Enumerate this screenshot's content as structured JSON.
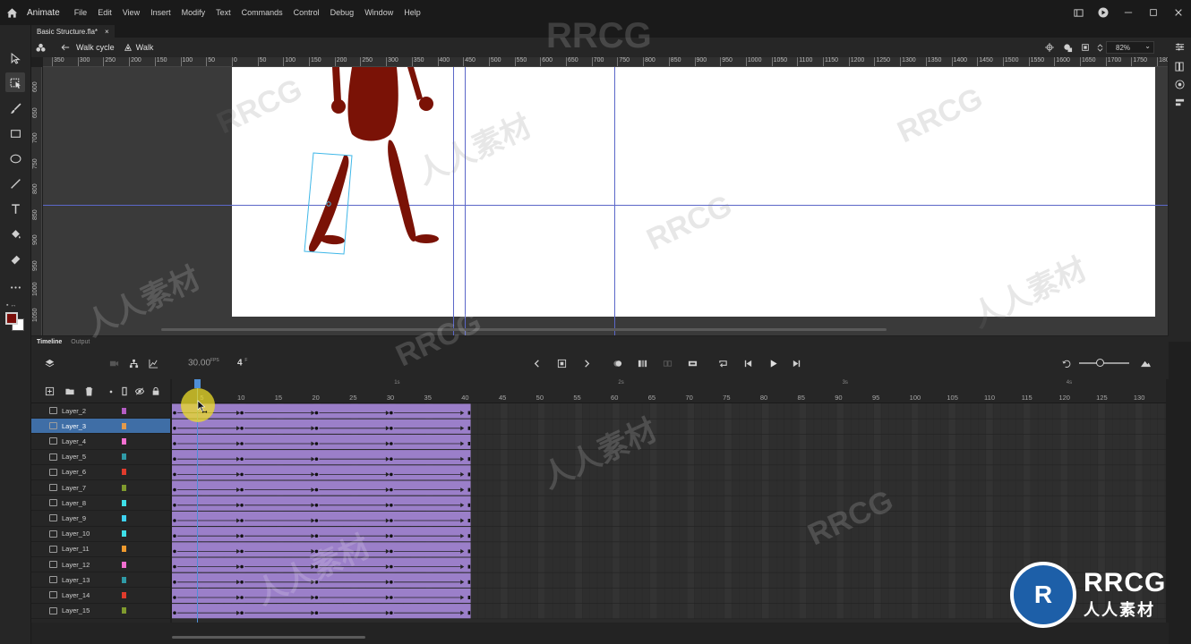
{
  "app": {
    "name": "Animate",
    "menu": [
      "File",
      "Edit",
      "View",
      "Insert",
      "Modify",
      "Text",
      "Commands",
      "Control",
      "Debug",
      "Window",
      "Help"
    ]
  },
  "document_tab": {
    "title": "Basic Structure.fla*",
    "close": "×"
  },
  "edit_bar": {
    "breadcrumb": [
      "Walk cycle",
      "Walk"
    ],
    "zoom": "82%"
  },
  "rulers": {
    "top_ticks": [
      "350",
      "300",
      "250",
      "200",
      "150",
      "100",
      "50",
      "0",
      "50",
      "100",
      "150",
      "200",
      "250",
      "300",
      "350",
      "400",
      "450",
      "500",
      "550",
      "600",
      "650",
      "700",
      "750",
      "800",
      "850",
      "900",
      "950",
      "1000",
      "1050",
      "1100",
      "1150",
      "1200",
      "1250",
      "1300",
      "1350",
      "1400",
      "1450",
      "1500",
      "1550",
      "1600",
      "1650",
      "1700",
      "1750",
      "180"
    ],
    "left_ticks": [
      "600",
      "650",
      "700",
      "750",
      "800",
      "850",
      "900",
      "950",
      "1000",
      "1050"
    ]
  },
  "timeline": {
    "tabs": {
      "timeline": "Timeline",
      "output": "Output"
    },
    "fps": "30.00",
    "fps_unit": "FPS",
    "current_frame": "4",
    "frame_unit": "F",
    "frame_numbers": [
      "5",
      "10",
      "15",
      "20",
      "25",
      "30",
      "35",
      "40",
      "45",
      "50",
      "55",
      "60",
      "65",
      "70",
      "75",
      "80",
      "85",
      "90",
      "95",
      "100",
      "105",
      "110",
      "115",
      "120",
      "125",
      "130"
    ],
    "second_markers": [
      "1s",
      "2s",
      "3s",
      "4s"
    ],
    "layers": [
      {
        "name": "Layer_2",
        "color": "#b45cc4",
        "selected": false
      },
      {
        "name": "Layer_3",
        "color": "#e39a4b",
        "selected": true
      },
      {
        "name": "Layer_4",
        "color": "#f26fd0",
        "selected": false
      },
      {
        "name": "Layer_5",
        "color": "#2f9aa6",
        "selected": false
      },
      {
        "name": "Layer_6",
        "color": "#e03b2c",
        "selected": false
      },
      {
        "name": "Layer_7",
        "color": "#7f9a2e",
        "selected": false
      },
      {
        "name": "Layer_8",
        "color": "#3ee0e8",
        "selected": false
      },
      {
        "name": "Layer_9",
        "color": "#3ed2f0",
        "selected": false
      },
      {
        "name": "Layer_10",
        "color": "#3ee0e8",
        "selected": false
      },
      {
        "name": "Layer_11",
        "color": "#f09a2e",
        "selected": false
      },
      {
        "name": "Layer_12",
        "color": "#f26fd0",
        "selected": false
      },
      {
        "name": "Layer_13",
        "color": "#2f9aa6",
        "selected": false
      },
      {
        "name": "Layer_14",
        "color": "#e03b2c",
        "selected": false
      },
      {
        "name": "Layer_15",
        "color": "#7f9a2e",
        "selected": false
      }
    ],
    "span_color": "#9b7fc9",
    "keyframes": [
      1,
      10,
      20,
      30
    ],
    "last_frame": 40
  },
  "colors": {
    "stroke_swatch": "#7a0e0a",
    "fill_swatch": "#ffffff",
    "figure": "#7a1206",
    "guide": "#5b67c8"
  },
  "watermark": {
    "text": "RRCG",
    "text_cn": "人人素材"
  }
}
